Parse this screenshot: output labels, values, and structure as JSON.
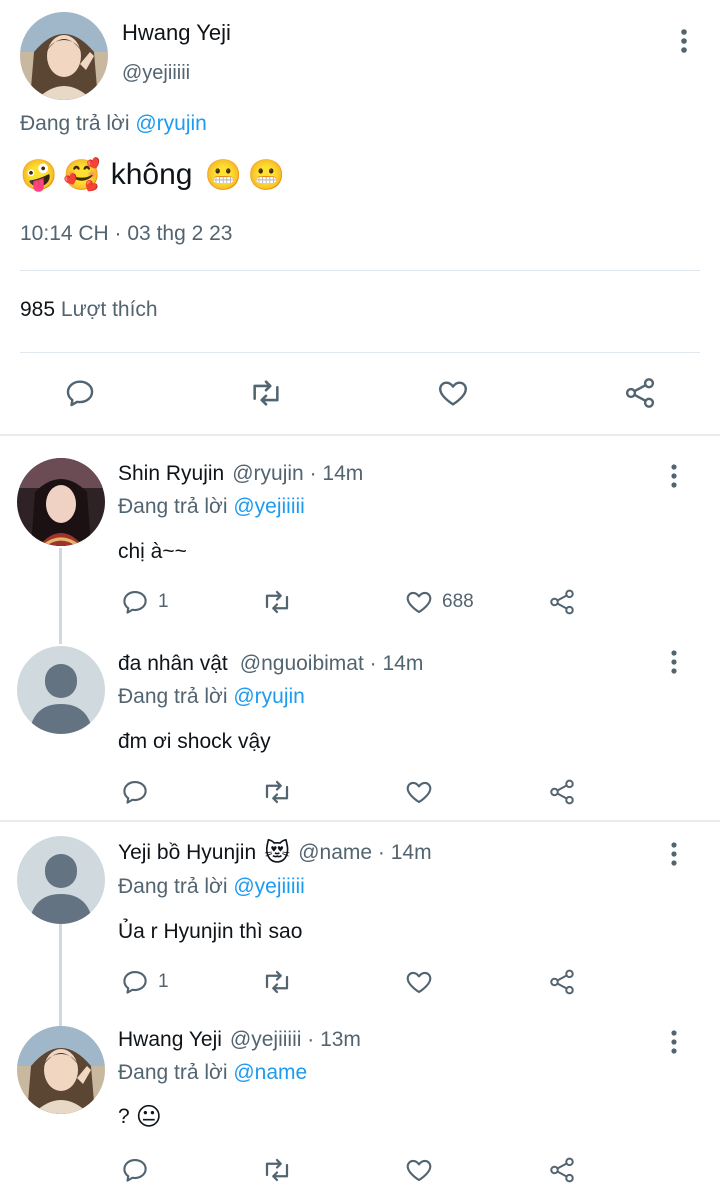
{
  "main_tweet": {
    "author_name": "Hwang Yeji",
    "author_handle": "@yejiiiii",
    "reply_prefix": "Đang trả lời",
    "reply_to": "@ryujin",
    "text": "không",
    "emoji_before": [
      "🤪",
      "🥰"
    ],
    "emoji_after": [
      "😬",
      "😬"
    ],
    "timestamp": "10:14 CH · 03 thg 2 23",
    "like_count": "985",
    "like_label": "Lượt thích",
    "icons": [
      "reply-icon",
      "retweet-icon",
      "like-icon",
      "share-icon"
    ]
  },
  "replies": [
    {
      "author_name": "Shin Ryujin",
      "handle_time": "@ryujin · 14m",
      "reply_prefix": "Đang trả lời",
      "reply_to": "@yejiiiii",
      "text": "chị à~~",
      "reply_count": "1",
      "like_count": "688"
    },
    {
      "author_name": "đa nhân vật",
      "handle_time": "@nguoibimat · 14m",
      "reply_prefix": "Đang trả lời",
      "reply_to": "@ryujin",
      "text": "đm ơi shock vậy",
      "reply_count": "",
      "like_count": ""
    },
    {
      "author_name": "Yeji bồ Hyunjin",
      "name_emoji": "😻",
      "handle_time": "@name · 14m",
      "reply_prefix": "Đang trả lời",
      "reply_to": "@yejiiiii",
      "text": "Ủa r Hyunjin thì sao",
      "reply_count": "1",
      "like_count": ""
    },
    {
      "author_name": "Hwang Yeji",
      "handle_time": "@yejiiiii · 13m",
      "reply_prefix": "Đang trả lời",
      "reply_to": "@name",
      "text": "?",
      "text_emoji": "😐",
      "reply_count": "",
      "like_count": ""
    }
  ],
  "colors": {
    "text": "#0f1419",
    "muted": "#536471",
    "link": "#1d9bf0",
    "divider": "#e1e8ed",
    "thread_line": "#cfd9de",
    "placeholder_avatar_bg": "#cfd9de",
    "placeholder_avatar_fg": "#637381"
  }
}
